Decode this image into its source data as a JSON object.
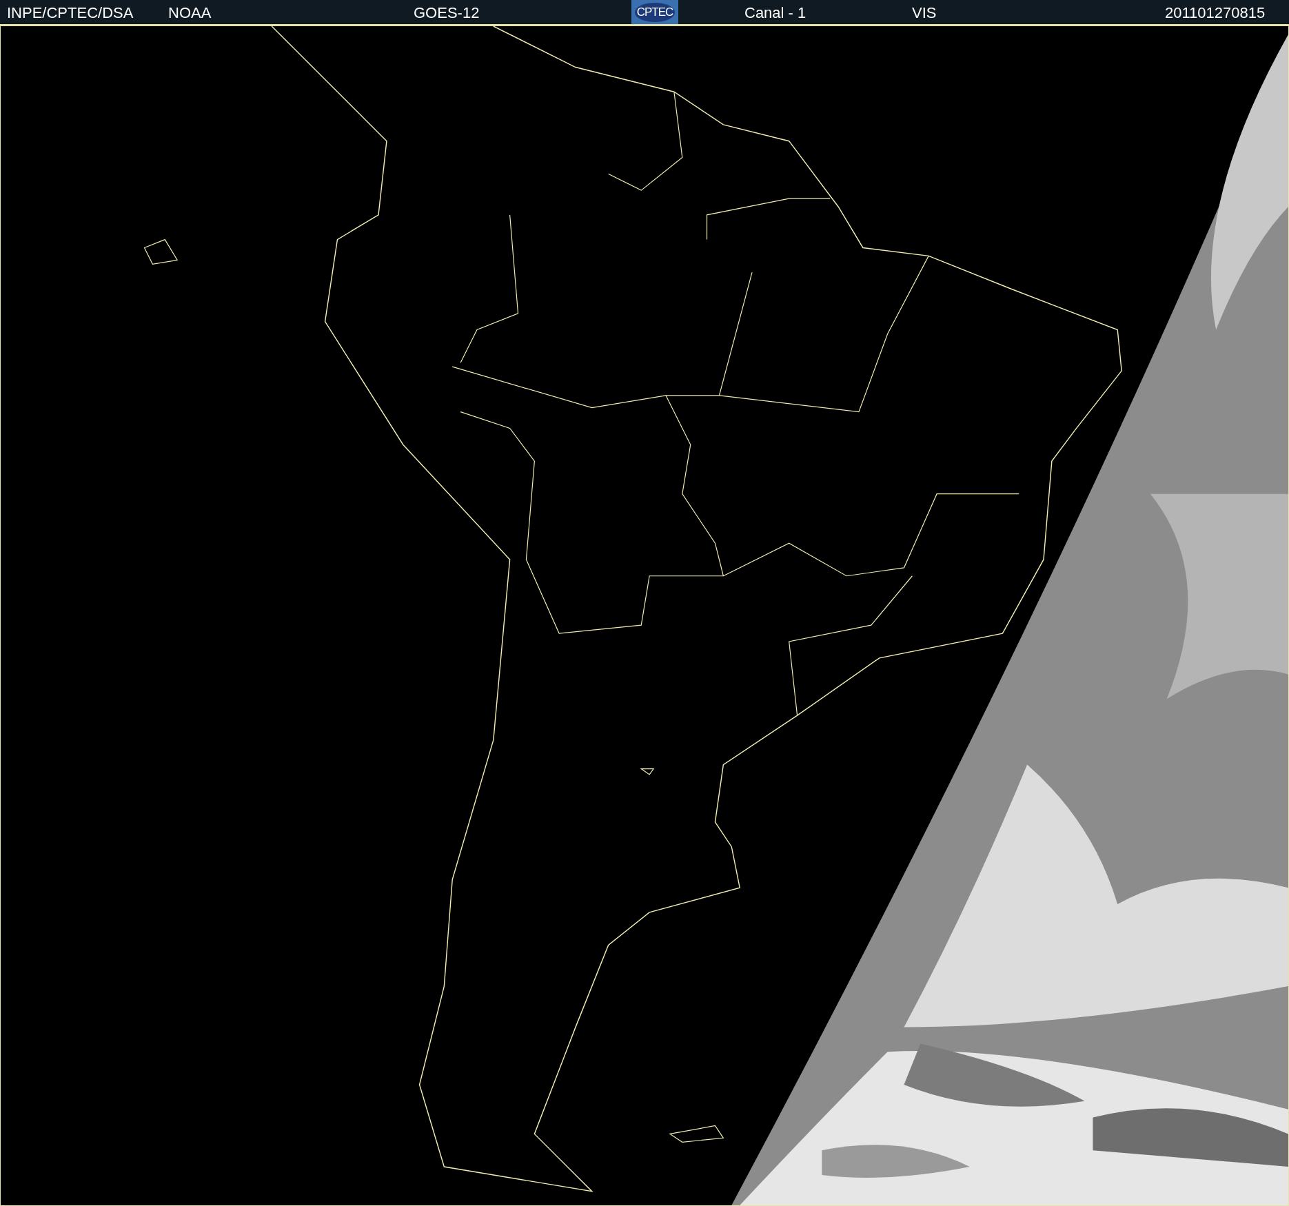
{
  "header": {
    "items": [
      {
        "kind": "text",
        "text": "INPE/CPTEC/DSA"
      },
      {
        "kind": "text",
        "text": "NOAA"
      },
      {
        "kind": "text",
        "text": "GOES-12"
      },
      {
        "kind": "logo",
        "text": "CPTEC"
      },
      {
        "kind": "text",
        "text": "Canal - 1"
      },
      {
        "kind": "text",
        "text": "VIS"
      },
      {
        "kind": "text",
        "text": "201101270815"
      }
    ]
  }
}
